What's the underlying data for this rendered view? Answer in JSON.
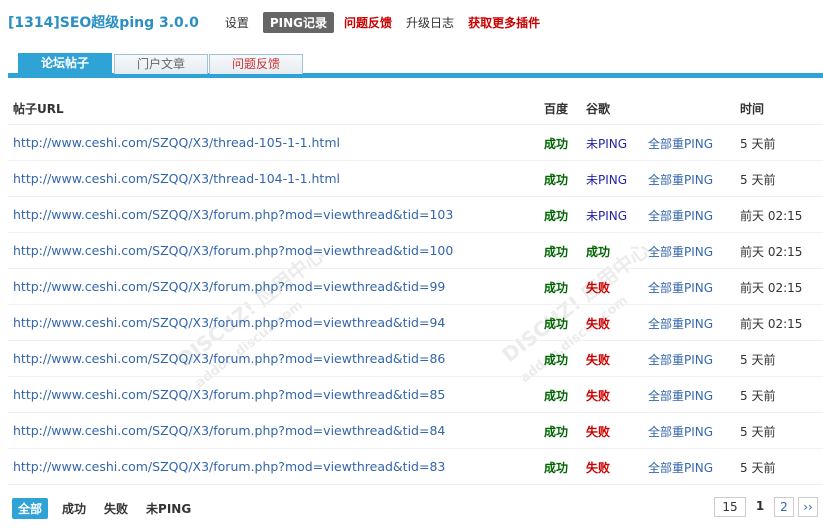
{
  "header": {
    "title": "[1314]SEO超级ping 3.0.0",
    "nav": [
      {
        "label": "设置",
        "style": "normal"
      },
      {
        "label": "PING记录",
        "style": "active"
      },
      {
        "label": "问题反馈",
        "style": "red"
      },
      {
        "label": "升级日志",
        "style": "normal"
      },
      {
        "label": "获取更多插件",
        "style": "red"
      }
    ]
  },
  "tabs": [
    {
      "label": "论坛帖子",
      "active": true
    },
    {
      "label": "门户文章",
      "active": false
    },
    {
      "label": "问题反馈",
      "active": false
    }
  ],
  "table": {
    "headers": {
      "url": "帖子URL",
      "baidu": "百度",
      "google": "谷歌",
      "time": "时间"
    },
    "rows": [
      {
        "url": "http://www.ceshi.com/SZQQ/X3/thread-105-1-1.html",
        "baidu": "成功",
        "google": "未PING",
        "reping": "全部重PING",
        "time": "5 天前"
      },
      {
        "url": "http://www.ceshi.com/SZQQ/X3/thread-104-1-1.html",
        "baidu": "成功",
        "google": "未PING",
        "reping": "全部重PING",
        "time": "5 天前"
      },
      {
        "url": "http://www.ceshi.com/SZQQ/X3/forum.php?mod=viewthread&tid=103",
        "baidu": "成功",
        "google": "未PING",
        "reping": "全部重PING",
        "time": "前天 02:15"
      },
      {
        "url": "http://www.ceshi.com/SZQQ/X3/forum.php?mod=viewthread&tid=100",
        "baidu": "成功",
        "google": "成功",
        "reping": "全部重PING",
        "time": "前天 02:15"
      },
      {
        "url": "http://www.ceshi.com/SZQQ/X3/forum.php?mod=viewthread&tid=99",
        "baidu": "成功",
        "google": "失败",
        "reping": "全部重PING",
        "time": "前天 02:15"
      },
      {
        "url": "http://www.ceshi.com/SZQQ/X3/forum.php?mod=viewthread&tid=94",
        "baidu": "成功",
        "google": "失败",
        "reping": "全部重PING",
        "time": "前天 02:15"
      },
      {
        "url": "http://www.ceshi.com/SZQQ/X3/forum.php?mod=viewthread&tid=86",
        "baidu": "成功",
        "google": "失败",
        "reping": "全部重PING",
        "time": "5 天前"
      },
      {
        "url": "http://www.ceshi.com/SZQQ/X3/forum.php?mod=viewthread&tid=85",
        "baidu": "成功",
        "google": "失败",
        "reping": "全部重PING",
        "time": "5 天前"
      },
      {
        "url": "http://www.ceshi.com/SZQQ/X3/forum.php?mod=viewthread&tid=84",
        "baidu": "成功",
        "google": "失败",
        "reping": "全部重PING",
        "time": "5 天前"
      },
      {
        "url": "http://www.ceshi.com/SZQQ/X3/forum.php?mod=viewthread&tid=83",
        "baidu": "成功",
        "google": "失败",
        "reping": "全部重PING",
        "time": "5 天前"
      }
    ]
  },
  "filters": [
    {
      "label": "全部",
      "active": true
    },
    {
      "label": "成功",
      "active": false
    },
    {
      "label": "失败",
      "active": false
    },
    {
      "label": "未PING",
      "active": false
    }
  ],
  "pager": {
    "total": "15",
    "current": "1",
    "next_page": "2",
    "next_label": "››"
  },
  "watermark": {
    "text": "DISCUZ! 应用中心",
    "sub": "addon.discuz.com"
  },
  "colors": {
    "accent": "#2fa2d6",
    "success": "#006600",
    "fail": "#cc0000",
    "link": "#3366aa",
    "title": "#2a8fc4"
  }
}
